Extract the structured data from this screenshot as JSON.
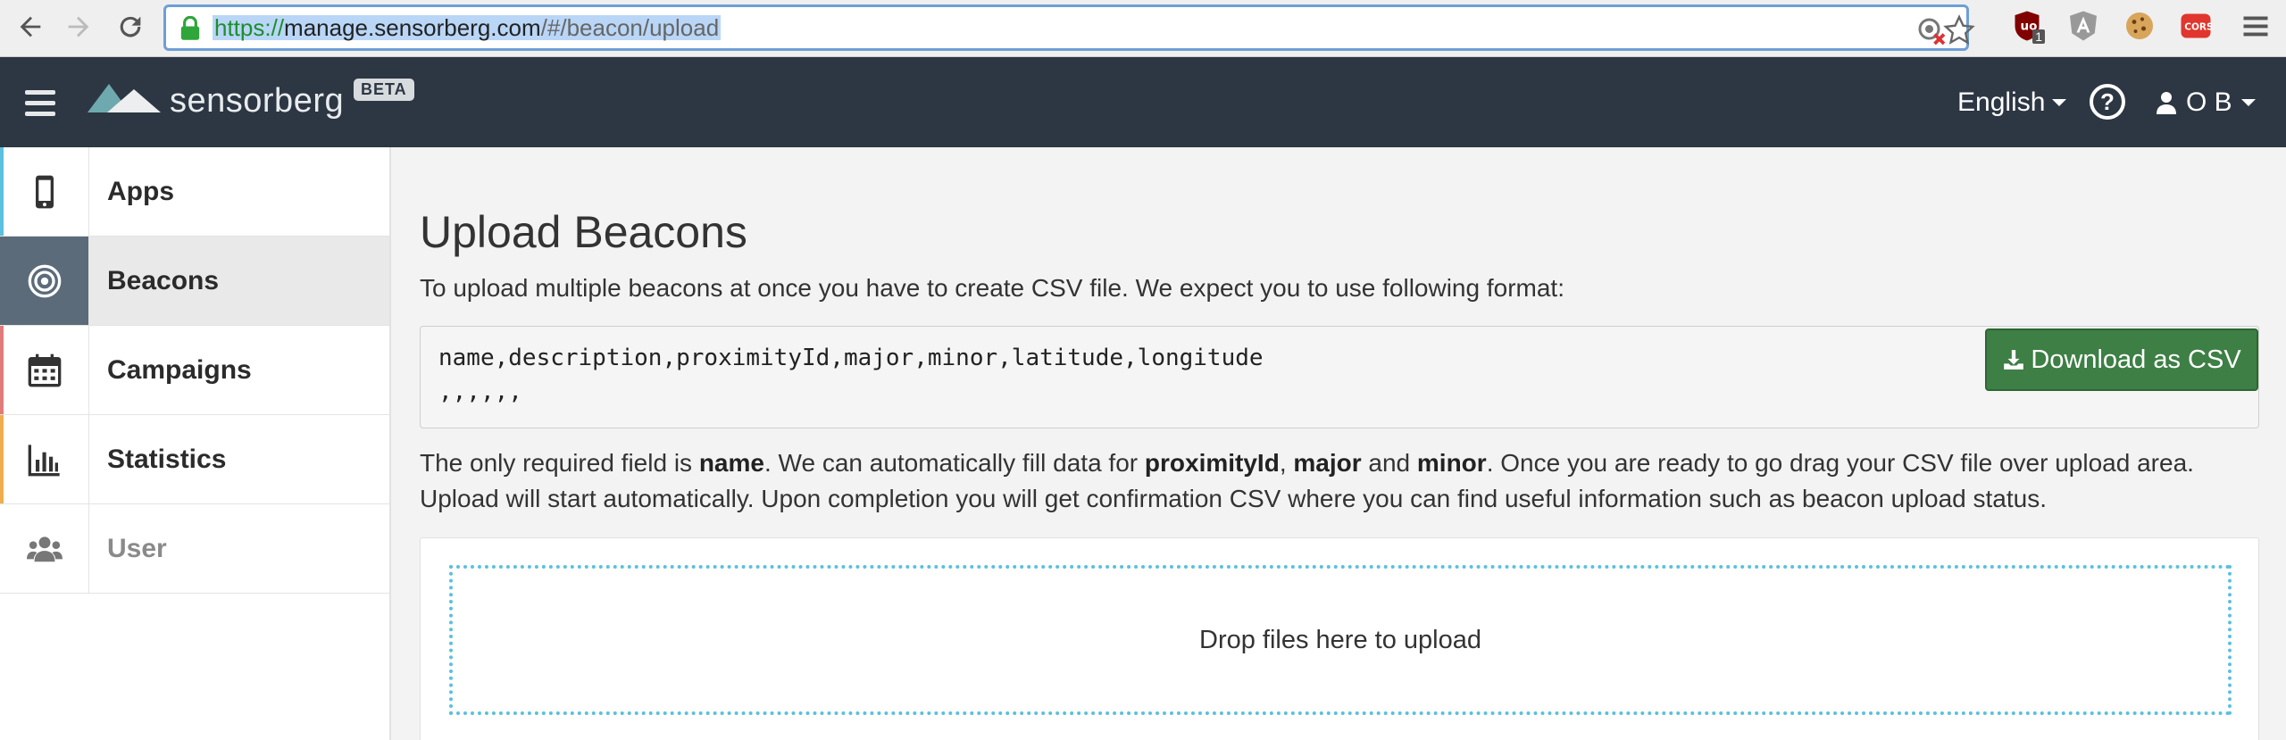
{
  "browser": {
    "url_scheme": "https://",
    "url_host": "manage.sensorberg.com",
    "url_path": "/#/beacon/upload",
    "extensions": [
      "ublock-icon",
      "angular-icon",
      "cookie-icon",
      "cors-icon"
    ],
    "ublock_badge": "1",
    "cors_label": "CORS"
  },
  "header": {
    "brand": "sensorberg",
    "badge": "BETA",
    "language": "English",
    "help_label": "?",
    "user": "O B"
  },
  "sidebar": {
    "items": [
      {
        "label": "Apps",
        "icon": "mobile-icon",
        "accent": "#5bc0de"
      },
      {
        "label": "Beacons",
        "icon": "beacon-icon",
        "accent": "#5b6b7a"
      },
      {
        "label": "Campaigns",
        "icon": "calendar-icon",
        "accent": "#e07b7b"
      },
      {
        "label": "Statistics",
        "icon": "bar-chart-icon",
        "accent": "#f0ad4e"
      },
      {
        "label": "User",
        "icon": "users-icon",
        "accent": ""
      }
    ]
  },
  "main": {
    "title": "Upload Beacons",
    "intro": "To upload multiple beacons at once you have to create CSV file. We expect you to use following format:",
    "csv_header": "name,description,proximityId,major,minor,latitude,longitude",
    "csv_row": ",,,,,,",
    "download_label": "Download as CSV",
    "note": {
      "p1": "The only required field is ",
      "b1": "name",
      "p2": ". We can automatically fill data for ",
      "b2": "proximityId",
      "p3": ", ",
      "b3": "major",
      "p4": " and ",
      "b4": "minor",
      "p5": ". Once you are ready to go drag your CSV file over upload area. Upload will start automatically. Upon completion you will get confirmation CSV where you can find useful information such as beacon upload status."
    },
    "dropzone_label": "Drop files here to upload"
  },
  "colors": {
    "header_bg": "#2d3743",
    "download_btn": "#3d7f45",
    "dropzone_border": "#5bc0de"
  }
}
